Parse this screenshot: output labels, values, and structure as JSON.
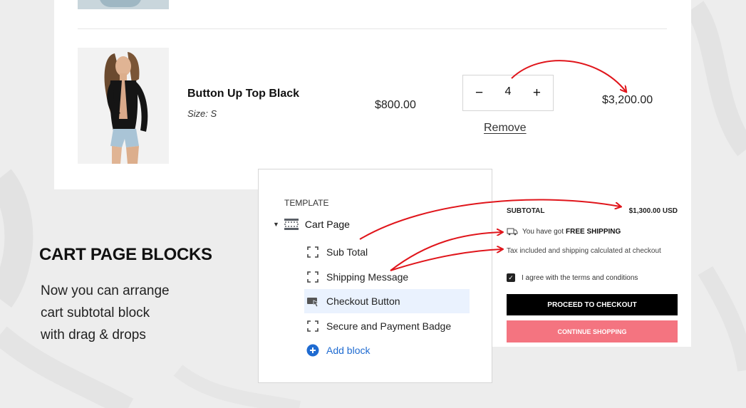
{
  "cart": {
    "item": {
      "name": "Button Up Top Black",
      "size": "Size: S",
      "price": "$800.00",
      "quantity": "4",
      "total": "$3,200.00",
      "remove_label": "Remove",
      "decrement_label": "−",
      "increment_label": "+"
    }
  },
  "feature": {
    "title": "CART PAGE BLOCKS",
    "desc_lines": [
      "Now you can arrange",
      "cart subtotal block",
      "with drag & drops"
    ]
  },
  "template_panel": {
    "heading": "TEMPLATE",
    "root": "Cart Page",
    "blocks": [
      "Sub Total",
      "Shipping Message",
      "Checkout Button",
      "Secure and Payment Badge"
    ],
    "add_block": "Add block"
  },
  "subtotal_panel": {
    "label": "SUBTOTAL",
    "amount": "$1,300.00 USD",
    "shipping_prefix": "You have got",
    "shipping_strong": "FREE SHIPPING",
    "tax_note": "Tax included and shipping calculated at checkout",
    "agree_label": "I agree with the terms and conditions",
    "checkout_label": "PROCEED TO CHECKOUT",
    "continue_label": "CONTINUE SHOPPING"
  },
  "colors": {
    "accent_red": "#e0151b",
    "continue_pink": "#f47480",
    "selected_bg": "#eaf2fe",
    "link_blue": "#1f6bd1"
  }
}
